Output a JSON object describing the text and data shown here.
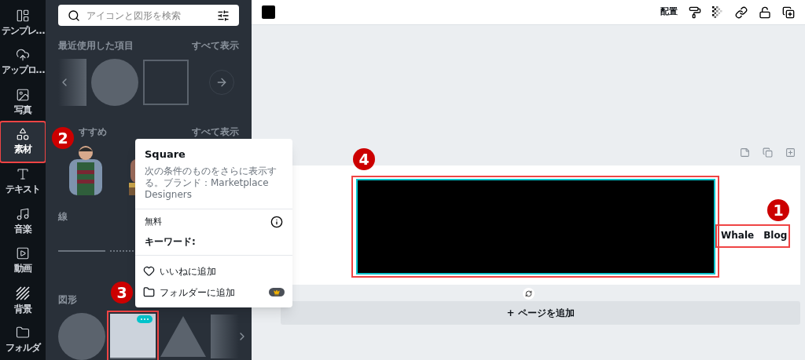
{
  "rail": [
    {
      "label": "テンプレ…",
      "selected": false
    },
    {
      "label": "アップロ…",
      "selected": false
    },
    {
      "label": "写真",
      "selected": false
    },
    {
      "label": "素材",
      "selected": true
    },
    {
      "label": "テキスト",
      "selected": false
    },
    {
      "label": "音楽",
      "selected": false
    },
    {
      "label": "動画",
      "selected": false
    },
    {
      "label": "背景",
      "selected": false
    },
    {
      "label": "フォルダ",
      "selected": false
    }
  ],
  "search": {
    "placeholder": "アイコンと図形を検索"
  },
  "sections": [
    {
      "title": "最近使用した項目",
      "see_all": "すべて表示",
      "kind": "recent"
    },
    {
      "title": "すすめ",
      "see_all": "すべて表示",
      "kind": "recommended"
    },
    {
      "title": "線",
      "kind": "lines"
    },
    {
      "title": "図形",
      "kind": "shapes"
    }
  ],
  "popup": {
    "title": "Square",
    "description": "次の条件のものをさらに表示する。ブランド：Marketplace Designers",
    "price": "無料",
    "keywords_label": "キーワード:",
    "actions": [
      {
        "label": "いいねに追加",
        "premium": false
      },
      {
        "label": "フォルダーに追加",
        "premium": true
      }
    ]
  },
  "toolbar": {
    "color": "#000000",
    "arrange": "配置"
  },
  "canvas": {
    "text": "Whale　Blog",
    "add_page": "+ ページを追加"
  },
  "annotations": [
    {
      "label": "1"
    },
    {
      "label": "2"
    },
    {
      "label": "3"
    },
    {
      "label": "4"
    }
  ]
}
